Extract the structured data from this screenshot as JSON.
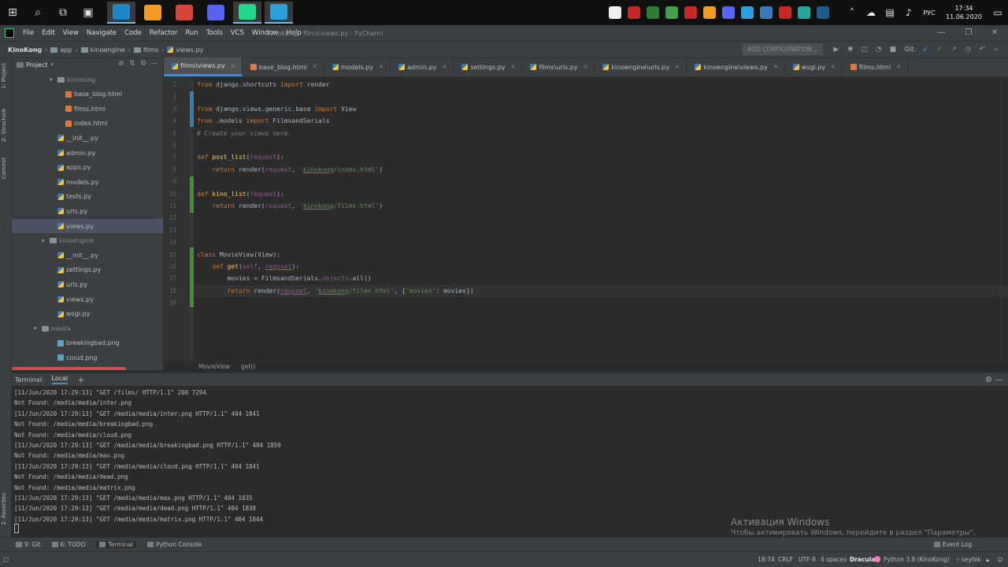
{
  "taskbar": {
    "apps": [
      {
        "name": "outlook",
        "color": "#1e88c7",
        "active": true
      },
      {
        "name": "sublime",
        "color": "#f29b24",
        "active": false
      },
      {
        "name": "chrome",
        "color": "#d9463c",
        "active": false
      },
      {
        "name": "discord",
        "color": "#5865f2",
        "active": false
      },
      {
        "name": "pycharm",
        "color": "#21d789",
        "active": true
      },
      {
        "name": "telegram",
        "color": "#2aa0da",
        "active": true
      }
    ],
    "tray_icons": [
      {
        "name": "file",
        "color": "#f0f0f0"
      },
      {
        "name": "snipping",
        "color": "#c62828"
      },
      {
        "name": "fps",
        "color": "#2e7d32"
      },
      {
        "name": "xbox",
        "color": "#43a047"
      },
      {
        "name": "dota",
        "color": "#c62828"
      },
      {
        "name": "sublime",
        "color": "#f29b24"
      },
      {
        "name": "discord",
        "color": "#5865f2"
      },
      {
        "name": "telegram",
        "color": "#2aa0da"
      },
      {
        "name": "python",
        "color": "#3d7ab8"
      },
      {
        "name": "aida64",
        "color": "#c62828"
      },
      {
        "name": "app-green",
        "color": "#26a69a"
      },
      {
        "name": "steam",
        "color": "#1b5f8a"
      }
    ],
    "language": "РУС",
    "time": "17:34",
    "date": "11.06.2020"
  },
  "menubar": {
    "items": [
      "File",
      "Edit",
      "View",
      "Navigate",
      "Code",
      "Refactor",
      "Run",
      "Tools",
      "VCS",
      "Window",
      "Help"
    ],
    "title": "KinoKong - films\\views.py - PyCharm"
  },
  "navbar": {
    "crumbs": [
      "KinoKong",
      "app",
      "kinoengine",
      "films",
      "views.py"
    ],
    "add_config": "ADD CONFIGURATION...",
    "git_label": "Git:"
  },
  "sidestrip": {
    "project": "1: Project",
    "structure": "Z: Structure",
    "commit": "Commit",
    "favorites": "2: Favorites"
  },
  "project_panel": {
    "title": "Project",
    "tree": [
      {
        "label": "kinokong",
        "type": "folder",
        "depth": 2,
        "expanded": true
      },
      {
        "label": "base_blog.html",
        "type": "html",
        "depth": 3
      },
      {
        "label": "films.html",
        "type": "html",
        "depth": 3
      },
      {
        "label": "index.html",
        "type": "html",
        "depth": 3
      },
      {
        "label": "__init__.py",
        "type": "py",
        "depth": 2
      },
      {
        "label": "admin.py",
        "type": "py",
        "depth": 2
      },
      {
        "label": "apps.py",
        "type": "py",
        "depth": 2
      },
      {
        "label": "models.py",
        "type": "py",
        "depth": 2
      },
      {
        "label": "tests.py",
        "type": "py",
        "depth": 2
      },
      {
        "label": "urls.py",
        "type": "py",
        "depth": 2
      },
      {
        "label": "views.py",
        "type": "py",
        "depth": 2,
        "selected": true
      },
      {
        "label": "kinoengine",
        "type": "folder",
        "depth": 1,
        "expanded": true
      },
      {
        "label": "__init__.py",
        "type": "py",
        "depth": 2
      },
      {
        "label": "settings.py",
        "type": "py",
        "depth": 2
      },
      {
        "label": "urls.py",
        "type": "py",
        "depth": 2
      },
      {
        "label": "views.py",
        "type": "py",
        "depth": 2
      },
      {
        "label": "wsgi.py",
        "type": "py",
        "depth": 2
      },
      {
        "label": "media",
        "type": "folder",
        "depth": 0,
        "expanded": true
      },
      {
        "label": "breakingbad.png",
        "type": "img",
        "depth": 2
      },
      {
        "label": "cloud.png",
        "type": "img",
        "depth": 2
      }
    ]
  },
  "tabs": [
    {
      "label": "films\\views.py",
      "type": "py",
      "active": true
    },
    {
      "label": "base_blog.html",
      "type": "html"
    },
    {
      "label": "models.py",
      "type": "py"
    },
    {
      "label": "admin.py",
      "type": "py"
    },
    {
      "label": "settings.py",
      "type": "py"
    },
    {
      "label": "films\\urls.py",
      "type": "py"
    },
    {
      "label": "kinoengine\\urls.py",
      "type": "py"
    },
    {
      "label": "kinoengine\\views.py",
      "type": "py"
    },
    {
      "label": "wsgi.py",
      "type": "py"
    },
    {
      "label": "films.html",
      "type": "html"
    }
  ],
  "editor": {
    "caret_line": 18,
    "lines": [
      [
        [
          "kw",
          "from "
        ],
        [
          "",
          "django.shortcuts "
        ],
        [
          "kw",
          "import "
        ],
        [
          "",
          "render"
        ]
      ],
      [],
      [
        [
          "kw",
          "from "
        ],
        [
          "",
          "django.views.generic.base "
        ],
        [
          "kw",
          "import "
        ],
        [
          "",
          "View"
        ]
      ],
      [
        [
          "kw",
          "from "
        ],
        [
          "",
          ".models "
        ],
        [
          "kw",
          "import "
        ],
        [
          "",
          "FilmsandSerials"
        ]
      ],
      [
        [
          "cmt",
          "# Create your views here."
        ]
      ],
      [],
      [
        [
          "kw",
          "def "
        ],
        [
          "fn",
          "post_list"
        ],
        [
          "",
          "("
        ],
        [
          "prm",
          "request"
        ],
        [
          "",
          "):"
        ]
      ],
      [
        [
          "",
          "    "
        ],
        [
          "kw",
          "return "
        ],
        [
          "",
          "render("
        ],
        [
          "prm",
          "request"
        ],
        [
          "",
          ", "
        ],
        [
          "str",
          "'"
        ],
        [
          "str und",
          "kinokong"
        ],
        [
          "str",
          "/index.html'"
        ],
        [
          "",
          ")"
        ]
      ],
      [],
      [
        [
          "kw",
          "def "
        ],
        [
          "fn",
          "kino_list"
        ],
        [
          "",
          "("
        ],
        [
          "prm",
          "request"
        ],
        [
          "",
          "):"
        ]
      ],
      [
        [
          "",
          "    "
        ],
        [
          "kw",
          "return "
        ],
        [
          "",
          "render("
        ],
        [
          "prm",
          "request"
        ],
        [
          "",
          ", "
        ],
        [
          "str",
          "'"
        ],
        [
          "str und",
          "kinokong"
        ],
        [
          "str",
          "/films.html'"
        ],
        [
          "",
          ")"
        ]
      ],
      [],
      [],
      [],
      [
        [
          "kw",
          "class "
        ],
        [
          "",
          "MovieView(View):"
        ]
      ],
      [
        [
          "",
          "    "
        ],
        [
          "kw",
          "def "
        ],
        [
          "fn",
          "get"
        ],
        [
          "",
          "("
        ],
        [
          "prm",
          "self"
        ],
        [
          "",
          ", "
        ],
        [
          "prm und",
          "requset"
        ],
        [
          "",
          "):"
        ]
      ],
      [
        [
          "",
          "        movies = FilmsandSerials."
        ],
        [
          "prm",
          "objects"
        ],
        [
          "",
          ".all()"
        ]
      ],
      [
        [
          "",
          "        "
        ],
        [
          "kw",
          "return "
        ],
        [
          "",
          "render("
        ],
        [
          "prm und",
          "requset"
        ],
        [
          "",
          ", "
        ],
        [
          "str",
          "'"
        ],
        [
          "str und",
          "kinokong"
        ],
        [
          "str",
          "/films.html'"
        ],
        [
          "",
          ", {"
        ],
        [
          "str",
          "'movies'"
        ],
        [
          "",
          ": movies})"
        ]
      ],
      []
    ]
  },
  "editor_crumbs": [
    "MovieView",
    "get()"
  ],
  "terminal": {
    "title": "Terminal:",
    "tab": "Local",
    "lines": [
      "[11/Jun/2020 17:29:13] \"GET /films/ HTTP/1.1\" 200 7294",
      "Not Found: /media/media/inter.png",
      "[11/Jun/2020 17:29:13] \"GET /media/media/inter.png HTTP/1.1\" 404 1841",
      "Not Found: /media/media/breakingbad.png",
      "Not Found: /media/media/cloud.png",
      "[11/Jun/2020 17:29:13] \"GET /media/media/breakingbad.png HTTP/1.1\" 404 1859",
      "Not Found: /media/media/max.png",
      "[11/Jun/2020 17:29:13] \"GET /media/media/cloud.png HTTP/1.1\" 404 1841",
      "Not Found: /media/media/dead.png",
      "Not Found: /media/media/matrix.png",
      "[11/Jun/2020 17:29:13] \"GET /media/media/max.png HTTP/1.1\" 404 1835",
      "[11/Jun/2020 17:29:13] \"GET /media/media/dead.png HTTP/1.1\" 404 1838",
      "[11/Jun/2020 17:29:13] \"GET /media/media/matrix.png HTTP/1.1\" 404 1844"
    ]
  },
  "activation": {
    "title": "Активация Windows",
    "subtitle": "Чтобы активировать Windows, перейдите в раздел \"Параметры\"."
  },
  "bottom_tools": {
    "git": "9: Git",
    "todo": "6: TODO",
    "terminal": "Terminal",
    "python_console": "Python Console",
    "event_log": "Event Log"
  },
  "status": {
    "position": "18:74",
    "line_sep": "CRLF",
    "encoding": "UTF-8",
    "indent": "4 spaces",
    "theme": "Dracula",
    "interpreter": "Python 3.8 (KinoKong)",
    "branch": "seytek"
  }
}
